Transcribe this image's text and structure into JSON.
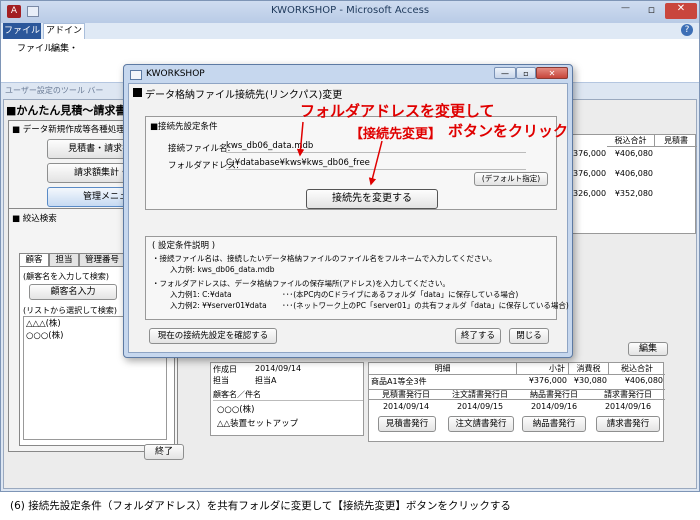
{
  "window": {
    "title": "KWORKSHOP - Microsoft Access",
    "controls": {
      "minimize": "—",
      "maximize": "▫",
      "close": "✕"
    },
    "help": "?"
  },
  "ribbon": {
    "file_tab": "ファイル",
    "addin_tab": "アドイン",
    "menu_file": "ファイル・",
    "menu_edit": "編集・",
    "toolbar_label": "ユーザー設定のツール バー"
  },
  "main_form": {
    "title": "■かんたん見積～請求書管",
    "data_section_label": "■ データ新規作成等各種処理",
    "btn_estimate": "見積書・請求書 新規",
    "btn_invoice_total": "請求額集計・入金",
    "btn_management": "管理メニュー",
    "filter_section_label": "■ 絞込検索",
    "tabs": [
      "顧客",
      "担当",
      "管理番号"
    ],
    "customer_hint": "(顧客名を入力して検索)",
    "customer_input_btn": "顧客名入力",
    "list_hint": "(リストから選択して検索)",
    "customer_list": [
      "△△△(株)",
      "○○○(株)"
    ],
    "exit_btn": "終了"
  },
  "results_table": {
    "headers": [
      "税込合計",
      "見積書"
    ],
    "rows": [
      {
        "left": "376,000",
        "total": "¥406,080"
      },
      {
        "left": "376,000",
        "total": "¥406,080"
      },
      {
        "left": "326,000",
        "total": "¥352,080"
      }
    ]
  },
  "detail": {
    "edit_btn": "編集",
    "created_label": "作成日",
    "created_value": "2014/09/14",
    "staff_label": "担当",
    "staff_value": "担当A",
    "customer_label": "顧客名／件名",
    "customer_value": "○○○(株)",
    "subject_value": "△△装置セットアップ",
    "line_header": "明細",
    "subtotal_header": "小計",
    "tax_header": "消費税",
    "tax_total_header": "税込合計",
    "item_name": "商品A1等全3件",
    "subtotal": "¥376,000",
    "tax": "¥30,080",
    "tax_total": "¥406,080",
    "issue_dates": [
      {
        "header": "見積書発行日",
        "date": "2014/09/14",
        "button": "見積書発行"
      },
      {
        "header": "注文請書発行日",
        "date": "2014/09/15",
        "button": "注文請書発行"
      },
      {
        "header": "納品書発行日",
        "date": "2014/09/16",
        "button": "納品書発行"
      },
      {
        "header": "請求書発行日",
        "date": "2014/09/16",
        "button": "請求書発行"
      }
    ]
  },
  "dialog": {
    "title": "KWORKSHOP",
    "heading": "データ格納ファイル接続先(リンクパス)変更",
    "conditions_label": "■接続先設定条件",
    "filename_label": "接続ファイル名:",
    "filename_value": "kws_db06_data.mdb",
    "folder_label": "フォルダアドレス:",
    "folder_value": "C:¥database¥kws¥kws_db06_free",
    "default_btn": "(デフォルト指定)",
    "change_btn": "接続先を変更する",
    "explanation_title": "( 設定条件説明 )",
    "explain_1": "・接続ファイル名は、接続したいデータ格納ファイルのファイル名をフルネームで入力してください。",
    "explain_1_example": "入力例:  kws_db06_data.mdb",
    "explain_2": "・フォルダアドレスは、データ格納ファイルの保存場所(アドレス)を入力してください。",
    "example_1_label": "入力例1:  C:¥data",
    "example_1_note": "･･･(本PC内のCドライブにあるフォルダ「data」に保存している場合)",
    "example_2_label": "入力例2:  ¥¥server01¥data",
    "example_2_note": "･･･(ネットワーク上のPC「server01」の共有フォルダ「data」に保存している場合)",
    "check_btn": "現在の接続先設定を確認する",
    "finish_btn": "終了する",
    "close_btn": "閉じる"
  },
  "annotations": {
    "line1": "フォルダアドレスを変更して",
    "line2_bracket": "【接続先変更】",
    "line2_rest": "ボタンをクリック"
  },
  "caption": "(6) 接続先設定条件（フォルダアドレス）を共有フォルダに変更して【接続先変更】ボタンをクリックする"
}
